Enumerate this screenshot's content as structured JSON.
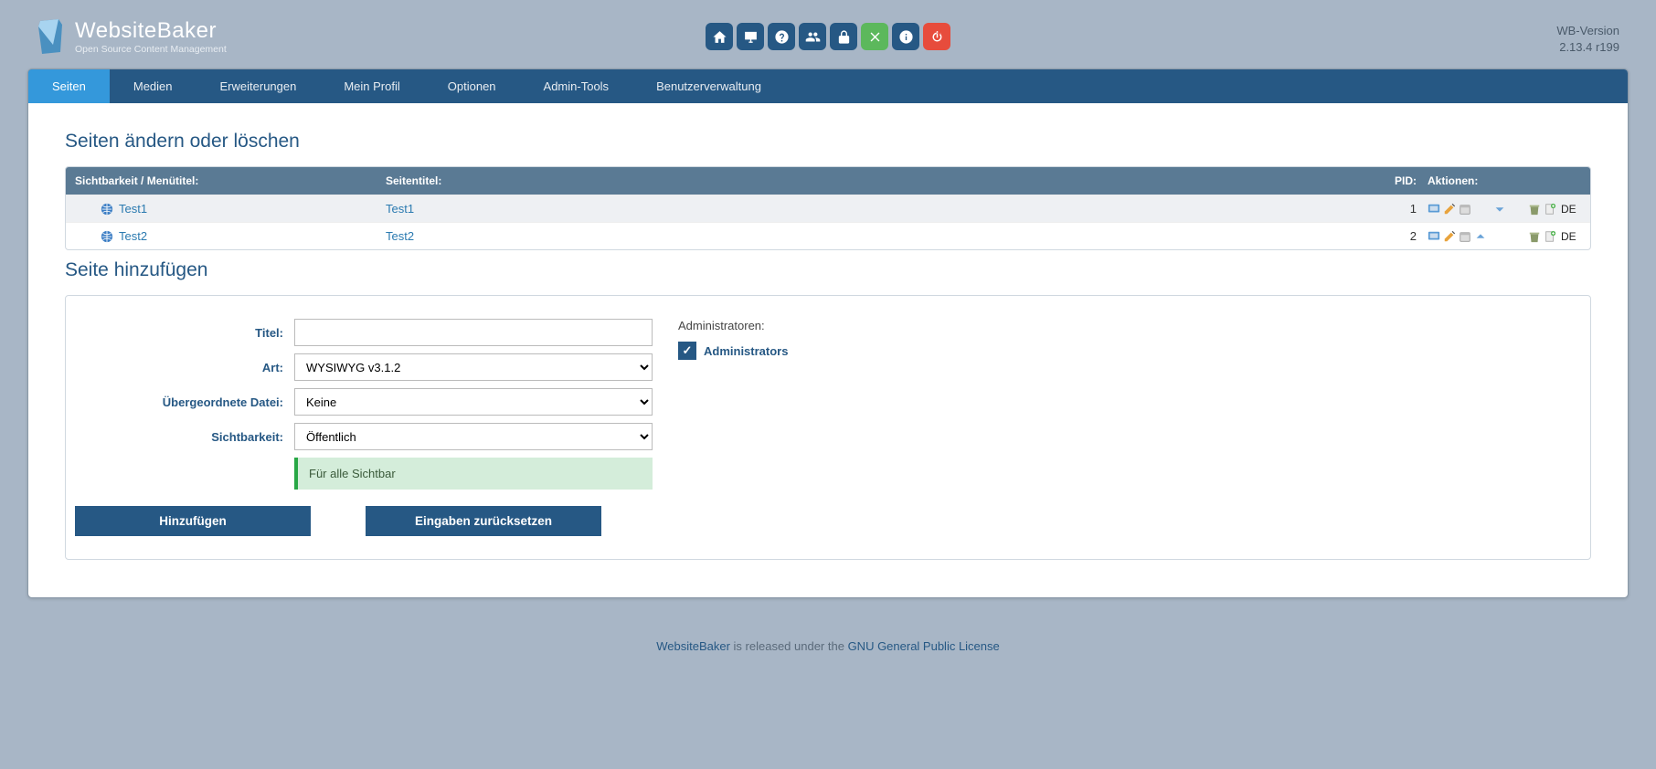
{
  "logo": {
    "main": "WebsiteBaker",
    "sub": "Open Source Content Management"
  },
  "version": {
    "label": "WB-Version",
    "value": "2.13.4 r199"
  },
  "tabs": [
    {
      "label": "Seiten",
      "active": true
    },
    {
      "label": "Medien"
    },
    {
      "label": "Erweiterungen"
    },
    {
      "label": "Mein Profil"
    },
    {
      "label": "Optionen"
    },
    {
      "label": "Admin-Tools"
    },
    {
      "label": "Benutzerverwaltung"
    }
  ],
  "headings": {
    "list": "Seiten ändern oder löschen",
    "add": "Seite hinzufügen"
  },
  "table": {
    "headers": {
      "vis": "Sichtbarkeit / Menütitel:",
      "title": "Seitentitel:",
      "pid": "PID:",
      "act": "Aktionen:"
    },
    "rows": [
      {
        "menu": "Test1",
        "title": "Test1",
        "pid": "1",
        "lang": "DE",
        "move": "down"
      },
      {
        "menu": "Test2",
        "title": "Test2",
        "pid": "2",
        "lang": "DE",
        "move": "up"
      }
    ]
  },
  "form": {
    "labels": {
      "title": "Titel:",
      "type": "Art:",
      "parent": "Übergeordnete Datei:",
      "vis": "Sichtbarkeit:"
    },
    "values": {
      "title": "",
      "type": "WYSIWYG v3.1.2",
      "parent": "Keine",
      "vis": "Öffentlich"
    },
    "hint": "Für alle Sichtbar",
    "buttons": {
      "add": "Hinzufügen",
      "reset": "Eingaben zurücksetzen"
    },
    "admins_label": "Administratoren:",
    "admins_group": "Administrators"
  },
  "footer": {
    "pre": "WebsiteBaker",
    "mid": " is released under the ",
    "link": "GNU General Public License"
  }
}
